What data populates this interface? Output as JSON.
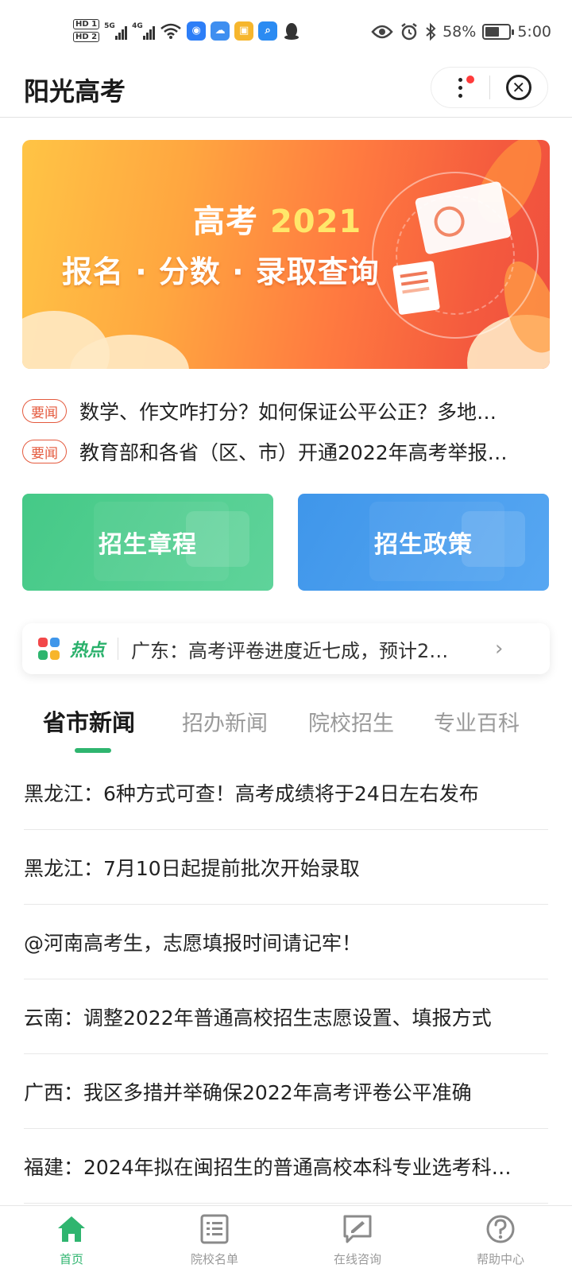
{
  "status_bar": {
    "hd1": "HD 1",
    "hd2": "HD 2",
    "net1": "5G",
    "net2": "4G",
    "battery": "58%",
    "battery_level": 0.58,
    "time": "5:00"
  },
  "header": {
    "title": "阳光高考"
  },
  "banner": {
    "subtitle_text": "高考",
    "subtitle_year": "2021",
    "main_text": "报名 · 分数 · 录取查询"
  },
  "news_items": [
    {
      "tag": "要闻",
      "text": "数学、作文咋打分？如何保证公平公正？多地…"
    },
    {
      "tag": "要闻",
      "text": "教育部和各省（区、市）开通2022年高考举报…"
    }
  ],
  "cards": {
    "left": "招生章程",
    "right": "招生政策"
  },
  "hotspot": {
    "label": "热点",
    "text": "广东：高考评卷进度近七成，预计2…",
    "colors": [
      "#f2484a",
      "#3f96ea",
      "#2fb56f",
      "#f7b52c"
    ]
  },
  "tabs": [
    {
      "label": "省市新闻",
      "active": true
    },
    {
      "label": "招办新闻",
      "active": false
    },
    {
      "label": "院校招生",
      "active": false
    },
    {
      "label": "专业百科",
      "active": false
    }
  ],
  "articles": [
    "黑龙江：6种方式可查！高考成绩将于24日左右发布",
    "黑龙江：7月10日起提前批次开始录取",
    "@河南高考生，志愿填报时间请记牢！",
    "云南：调整2022年普通高校招生志愿设置、填报方式",
    "广西：我区多措并举确保2022年高考评卷公平准确",
    "福建：2024年拟在闽招生的普通高校本科专业选考科…"
  ],
  "bottom_nav": [
    {
      "label": "首页",
      "icon": "home-icon",
      "active": true
    },
    {
      "label": "院校名单",
      "icon": "list-icon",
      "active": false
    },
    {
      "label": "在线咨询",
      "icon": "edit-chat-icon",
      "active": false
    },
    {
      "label": "帮助中心",
      "icon": "help-icon",
      "active": false
    }
  ],
  "colors": {
    "accent_green": "#2fb56f",
    "tag_red": "#e45a3e",
    "card_green": "#45c987",
    "card_blue": "#3f96ea"
  }
}
